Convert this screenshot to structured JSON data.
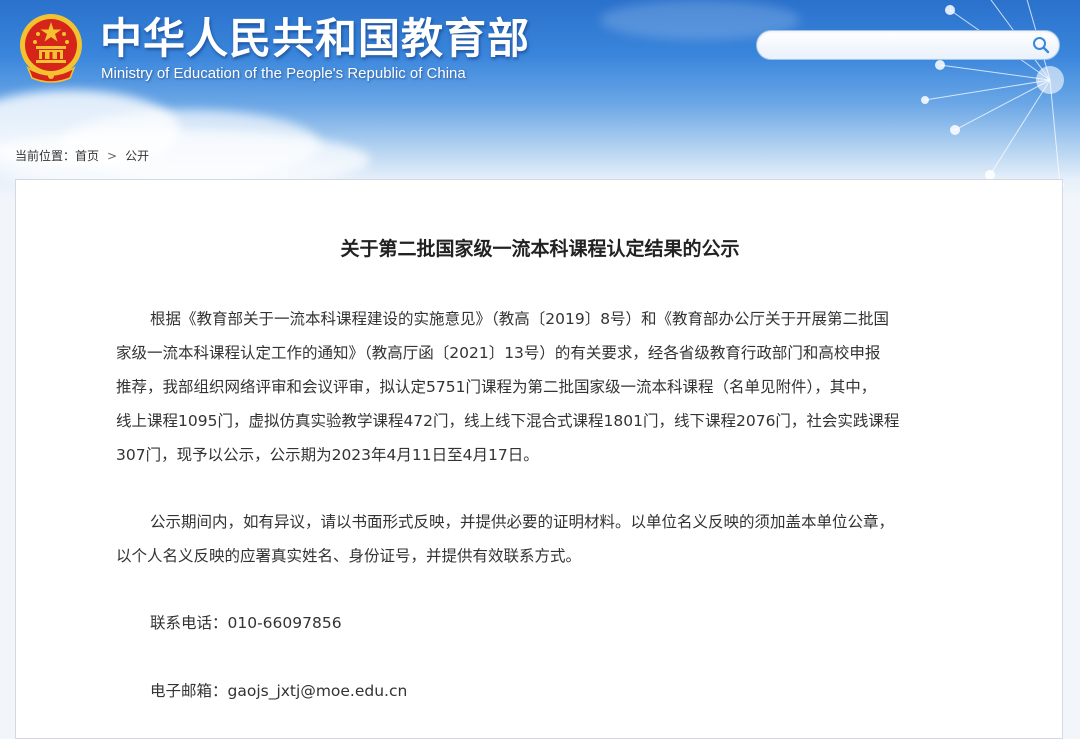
{
  "header": {
    "title": "中华人民共和国教育部",
    "subtitle": "Ministry of Education of the People's Republic of China",
    "search_placeholder": "",
    "colors": {
      "banner_top": "#2a71cc",
      "emblem_red": "#d7241b",
      "emblem_gold": "#f3c230"
    },
    "icons": [
      "national-emblem-icon",
      "search-icon"
    ]
  },
  "breadcrumb": {
    "prefix": "当前位置：",
    "items": [
      "首页",
      "公开"
    ],
    "separator": ">"
  },
  "article": {
    "title": "关于第二批国家级一流本科课程认定结果的公示",
    "paragraph1_lines": [
      "根据《教育部关于一流本科课程建设的实施意见》（教高〔2019〕8号）和《教育部办公厅关于开展第二批国",
      "家级一流本科课程认定工作的通知》（教高厅函〔2021〕13号）的有关要求，经各省级教育行政部门和高校申报",
      "推荐，我部组织网络评审和会议评审，拟认定5751门课程为第二批国家级一流本科课程（名单见附件），其中，",
      "线上课程1095门，虚拟仿真实验教学课程472门，线上线下混合式课程1801门，线下课程2076门，社会实践课程",
      "307门，现予以公示，公示期为2023年4月11日至4月17日。"
    ],
    "paragraph2_lines": [
      "公示期间内，如有异议，请以书面形式反映，并提供必要的证明材料。以单位名义反映的须加盖本单位公章，",
      "以个人名义反映的应署真实姓名、身份证号，并提供有效联系方式。"
    ],
    "contact_phone": "联系电话：010-66097856",
    "contact_email": "电子邮箱：gaojs_jxtj@moe.edu.cn"
  }
}
